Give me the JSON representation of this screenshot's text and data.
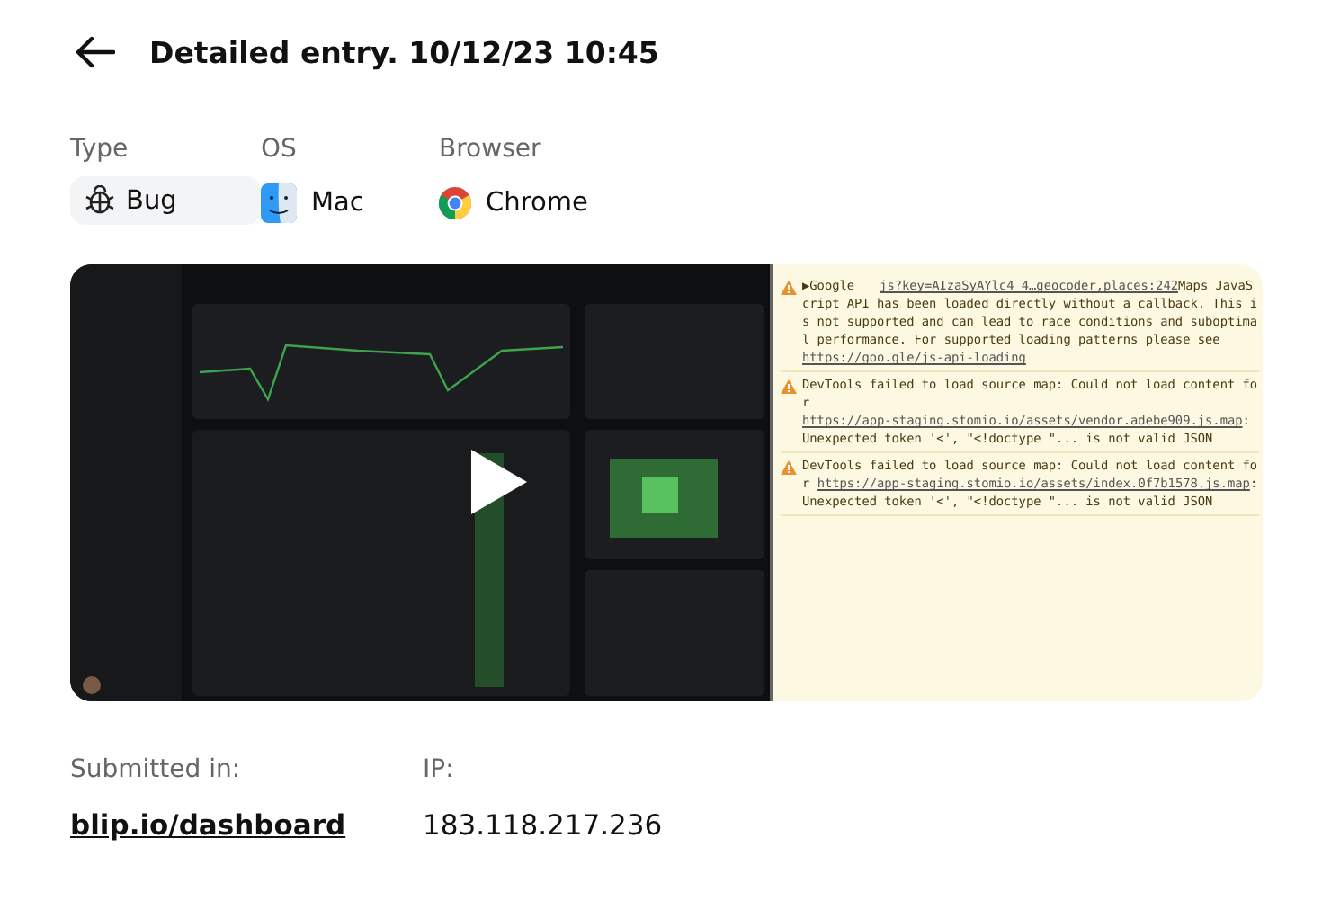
{
  "header": {
    "title": "Detailed entry. 10/12/23 10:45"
  },
  "fields": [
    {
      "label": "Type",
      "value": "Bug",
      "kind": "bug"
    },
    {
      "label": "OS",
      "value": "Mac",
      "kind": "mac"
    },
    {
      "label": "Browser",
      "value": "Chrome",
      "kind": "chrome"
    }
  ],
  "recording": {
    "kind": "picture",
    "console": [
      {
        "parts": [
          {
            "kind": "source",
            "text": "▶Google"
          },
          {
            "kind": "link",
            "text": "js?key=AIzaSyAYlc4_4…geocoder,places:242"
          },
          {
            "kind": "text",
            "text": "Maps JavaScript API has been loaded directly without a callback. This is not supported and can lead to race conditions and suboptimal performance. For supported loading patterns please see "
          },
          {
            "kind": "link",
            "text": "https://goo.gle/js-api-loading"
          }
        ]
      },
      {
        "parts": [
          {
            "kind": "text",
            "text": "DevTools failed to load source map: Could not load content for "
          },
          {
            "kind": "link",
            "text": "https://app-staging.stomio.io/assets/vendor.adebe909.js.map"
          },
          {
            "kind": "text",
            "text": ": Unexpected token '<', \"<!doctype \"... is not valid JSON"
          }
        ]
      },
      {
        "parts": [
          {
            "kind": "text",
            "text": "DevTools failed to load source map: Could not load content for "
          },
          {
            "kind": "link",
            "text": "https://app-staging.stomio.io/assets/index.0f7b1578.js.map"
          },
          {
            "kind": "text",
            "text": ": Unexpected token '<', \"<!doctype \"... is not valid JSON"
          }
        ]
      }
    ]
  },
  "details": [
    {
      "label": "Submitted in:",
      "value": "blip.io/dashboard",
      "kind": "link"
    },
    {
      "label": "IP:",
      "value": "183.118.217.236",
      "kind": "text"
    }
  ]
}
